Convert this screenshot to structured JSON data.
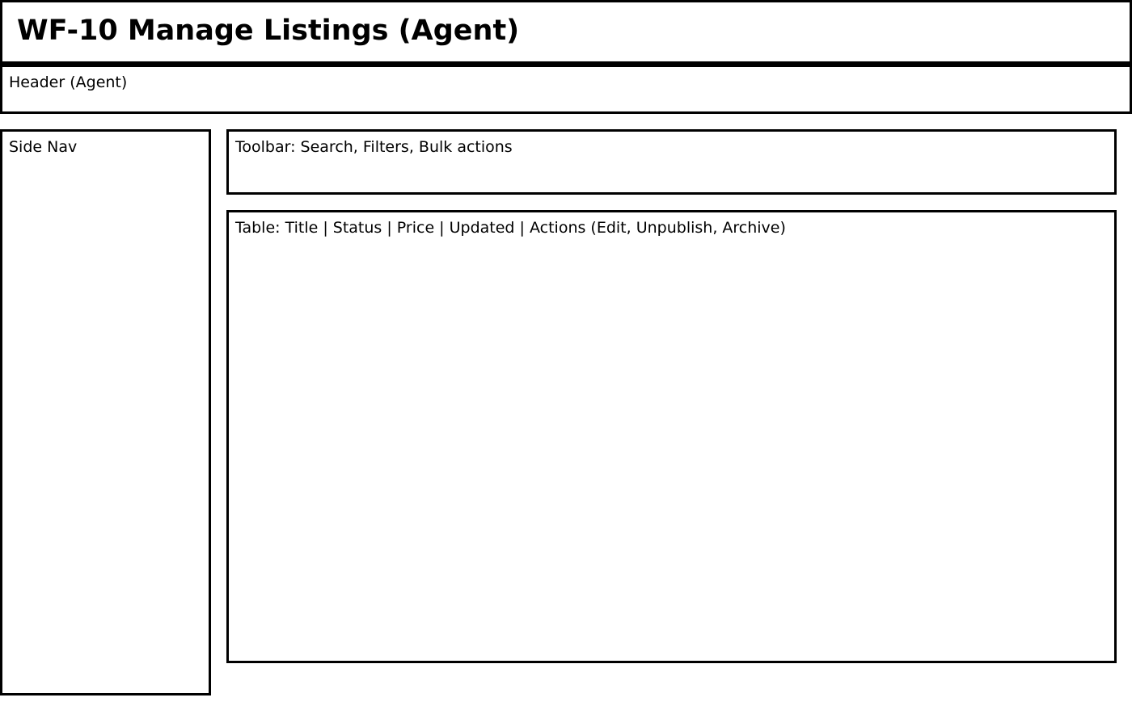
{
  "page_title": "WF-10 Manage Listings (Agent)",
  "regions": {
    "header": "Header (Agent)",
    "side_nav": "Side Nav",
    "toolbar": "Toolbar: Search, Filters, Bulk actions",
    "table": "Table: Title | Status | Price | Updated | Actions (Edit, Unpublish, Archive)"
  },
  "colors": {
    "stroke": "#000000",
    "background": "#ffffff"
  }
}
